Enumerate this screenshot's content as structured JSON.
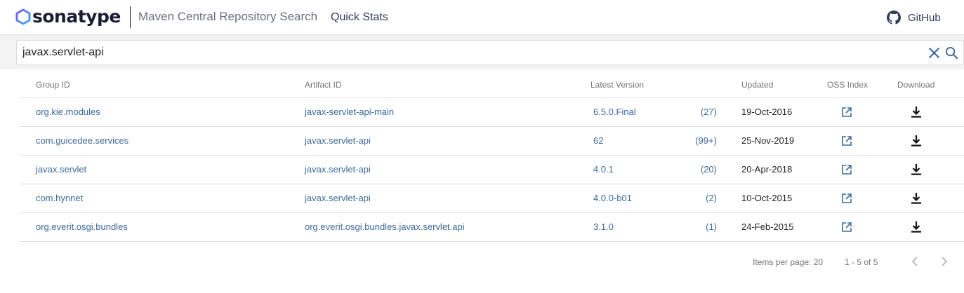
{
  "header": {
    "brand": "sonatype",
    "app_title": "Maven Central Repository Search",
    "nav_quick_stats": "Quick Stats",
    "github_label": "GitHub"
  },
  "search": {
    "value": "javax.servlet-api"
  },
  "table": {
    "columns": {
      "group_id": "Group ID",
      "artifact_id": "Artifact ID",
      "latest_version": "Latest Version",
      "updated": "Updated",
      "oss_index": "OSS Index",
      "download": "Download"
    },
    "rows": [
      {
        "group_id": "org.kie.modules",
        "artifact_id": "javax-servlet-api-main",
        "version": "6.5.0.Final",
        "count": "(27)",
        "updated": "19-Oct-2016"
      },
      {
        "group_id": "com.guicedee.services",
        "artifact_id": "javax.servlet-api",
        "version": "62",
        "count": "(99+)",
        "updated": "25-Nov-2019"
      },
      {
        "group_id": "javax.servlet",
        "artifact_id": "javax.servlet-api",
        "version": "4.0.1",
        "count": "(20)",
        "updated": "20-Apr-2018"
      },
      {
        "group_id": "com.hynnet",
        "artifact_id": "javax.servlet-api",
        "version": "4.0.0-b01",
        "count": "(2)",
        "updated": "10-Oct-2015"
      },
      {
        "group_id": "org.everit.osgi.bundles",
        "artifact_id": "org.everit.osgi.bundles.javax.servlet.api",
        "version": "3.1.0",
        "count": "(1)",
        "updated": "24-Feb-2015"
      }
    ]
  },
  "pagination": {
    "items_per_page_label": "Items per page: 20",
    "range_label": "1 - 5 of 5"
  },
  "icons": {
    "logo": "sonatype-hexagon-icon",
    "github": "github-icon",
    "clear": "close-icon",
    "search": "search-icon",
    "oss_index": "external-link-icon",
    "download": "download-icon",
    "prev": "chevron-left-icon",
    "next": "chevron-right-icon"
  },
  "colors": {
    "link": "#3d6a9b",
    "brand_text": "#1b1c33",
    "logo_gradient_start": "#7b5cf0",
    "logo_gradient_end": "#3fa9f5"
  }
}
